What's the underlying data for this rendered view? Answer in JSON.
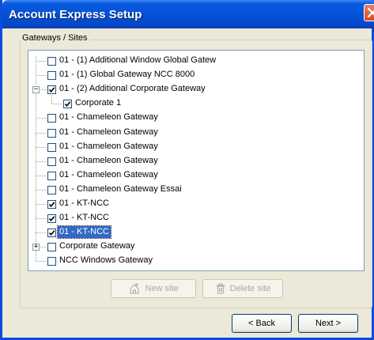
{
  "window": {
    "title": "Account Express Setup"
  },
  "group": {
    "label": "Gateways / Sites"
  },
  "tree": {
    "items": [
      {
        "label": "01 - (1) Additional Window Global Gatew",
        "checked": false
      },
      {
        "label": "01 - (1) Global Gateway NCC 8000",
        "checked": false
      },
      {
        "label": "01 - (2) Additional Corporate Gateway",
        "checked": true,
        "expanded": true
      },
      {
        "label": "Corporate 1",
        "checked": true,
        "child": true
      },
      {
        "label": "01 - Chameleon Gateway",
        "checked": false
      },
      {
        "label": "01 - Chameleon Gateway",
        "checked": false
      },
      {
        "label": "01 - Chameleon Gateway",
        "checked": false
      },
      {
        "label": "01 - Chameleon Gateway",
        "checked": false
      },
      {
        "label": "01 - Chameleon Gateway",
        "checked": false
      },
      {
        "label": "01 - Chameleon Gateway Essai",
        "checked": false
      },
      {
        "label": "01 - KT-NCC",
        "checked": true
      },
      {
        "label": "01 - KT-NCC",
        "checked": true
      },
      {
        "label": "01 - KT-NCC",
        "checked": true,
        "selected": true
      },
      {
        "label": "Corporate Gateway",
        "checked": false,
        "collapsed": true
      },
      {
        "label": "NCC Windows Gateway",
        "checked": false
      }
    ]
  },
  "buttons": {
    "new_site": "New site",
    "delete_site": "Delete site",
    "back": "< Back",
    "next": "Next >"
  },
  "colors": {
    "title_bar": "#0551d8",
    "selection": "#316ac5",
    "dialog_bg": "#ece9d8"
  }
}
